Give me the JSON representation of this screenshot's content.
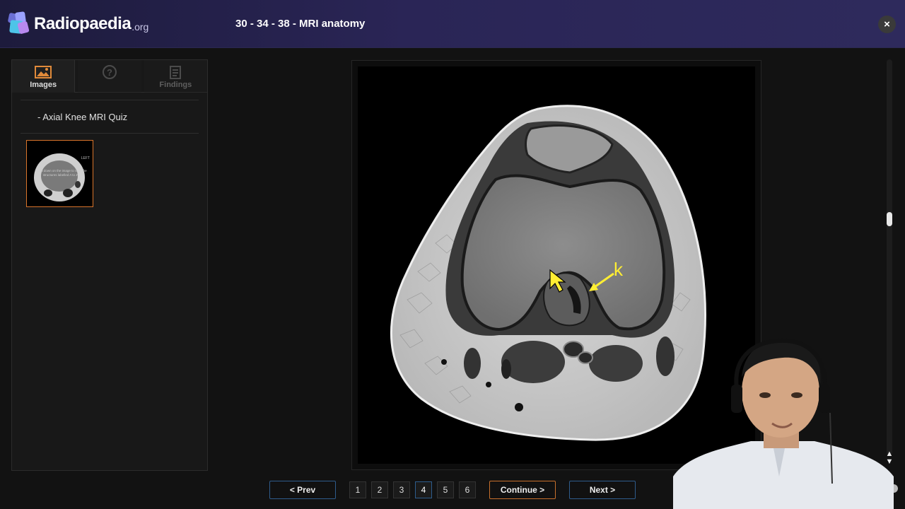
{
  "app": {
    "brand": "Radiopaedia",
    "brand_suffix": ".org",
    "title": "30 - 34 - 38 - MRI anatomy",
    "close_glyph": "×"
  },
  "sidebar": {
    "tabs": [
      {
        "label": "Images",
        "icon": "image-icon",
        "active": true
      },
      {
        "label": "",
        "icon": "question-icon",
        "active": false
      },
      {
        "label": "Findings",
        "icon": "findings-icon",
        "active": false
      }
    ],
    "quiz_title": "- Axial Knee MRI Quiz",
    "thumbnail": {
      "tag": "LEFT",
      "caption": "Scroll down on the image to view the structures labelled A to Z."
    }
  },
  "viewer": {
    "annotation_label": "k",
    "annotation_color": "#ffee33",
    "cursor_color": "#ffee33"
  },
  "pagination": {
    "prev_label": "<  Prev",
    "next_label": "Next  >",
    "continue_label": "Continue    >",
    "pages": [
      "1",
      "2",
      "3",
      "4",
      "5",
      "6"
    ],
    "current_page": "4"
  },
  "colors": {
    "topbar": "#2a2556",
    "accent_orange": "#d9742b",
    "accent_blue": "#2e5c8c"
  }
}
